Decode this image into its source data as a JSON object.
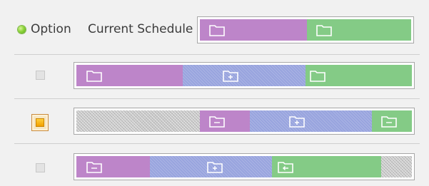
{
  "header": {
    "option_label": "Option",
    "current_label": "Current Schedule"
  },
  "colors": {
    "purple": "#bd85c9",
    "blue": "#98a4de",
    "green": "#84cb86",
    "gray": "#c7c7c7",
    "selected_checkbox": "#f2a000"
  },
  "segment_types": {
    "purple": "folder-icon",
    "blue": "folder-plus-icon",
    "green": "folder-icon",
    "gray": "none"
  },
  "rows": [
    {
      "name": "current-schedule",
      "selected": null
    },
    {
      "name": "option-1",
      "selected": false
    },
    {
      "name": "option-2",
      "selected": true
    },
    {
      "name": "option-3",
      "selected": false
    }
  ]
}
